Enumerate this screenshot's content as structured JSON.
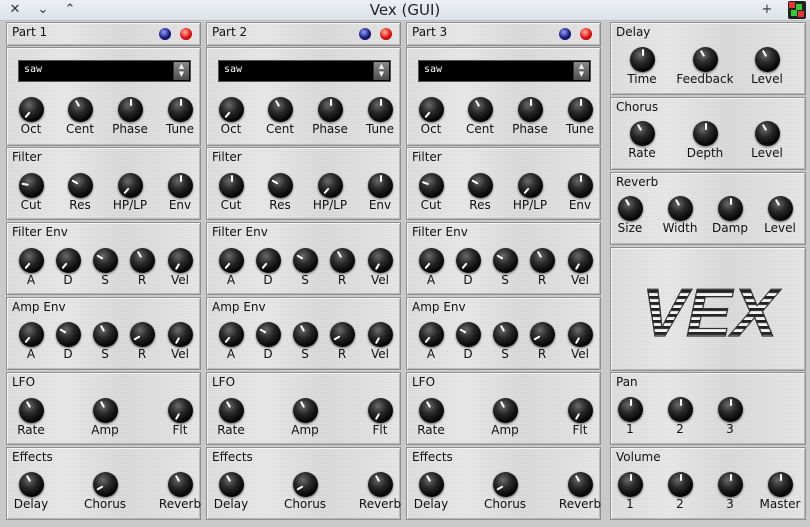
{
  "window": {
    "title": "Vex (GUI)",
    "buttons": {
      "close": "✕",
      "minimize": "⌄",
      "maximize": "⌃",
      "pin": "+"
    }
  },
  "parts": [
    {
      "title": "Part 1",
      "waveform": "saw"
    },
    {
      "title": "Part 2",
      "waveform": "saw"
    },
    {
      "title": "Part 3",
      "waveform": "saw"
    }
  ],
  "osc_labels": [
    "Oct",
    "Cent",
    "Phase",
    "Tune"
  ],
  "sections": {
    "filter": {
      "title": "Filter",
      "labels": [
        "Cut",
        "Res",
        "HP/LP",
        "Env"
      ]
    },
    "filter_env": {
      "title": "Filter Env",
      "labels": [
        "A",
        "D",
        "S",
        "R",
        "Vel"
      ]
    },
    "amp_env": {
      "title": "Amp Env",
      "labels": [
        "A",
        "D",
        "S",
        "R",
        "Vel"
      ]
    },
    "lfo": {
      "title": "LFO",
      "labels": [
        "Rate",
        "Amp",
        "Flt"
      ]
    },
    "effects": {
      "title": "Effects",
      "labels": [
        "Delay",
        "Chorus",
        "Reverb"
      ]
    }
  },
  "master": {
    "delay": {
      "title": "Delay",
      "labels": [
        "Time",
        "Feedback",
        "Level"
      ]
    },
    "chorus": {
      "title": "Chorus",
      "labels": [
        "Rate",
        "Depth",
        "Level"
      ]
    },
    "reverb": {
      "title": "Reverb",
      "labels": [
        "Size",
        "Width",
        "Damp",
        "Level"
      ]
    },
    "logo": "VEX",
    "pan": {
      "title": "Pan",
      "labels": [
        "1",
        "2",
        "3"
      ]
    },
    "volume": {
      "title": "Volume",
      "labels": [
        "1",
        "2",
        "3",
        "Master"
      ]
    }
  }
}
